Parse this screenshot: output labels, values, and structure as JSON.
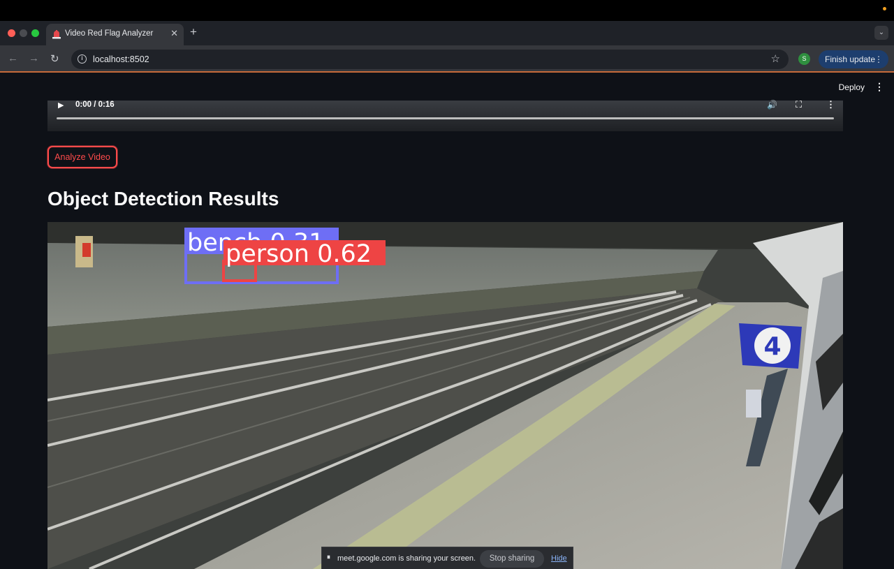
{
  "browser": {
    "tab_title": "Video Red Flag Analyzer",
    "tab_icon": "siren-icon",
    "new_tab_label": "+",
    "url": "localhost:8502",
    "profile_initial": "S",
    "finish_update_label": "Finish update"
  },
  "app": {
    "deploy_label": "Deploy",
    "video": {
      "time": "0:00 / 0:16",
      "progress": 0
    },
    "analyze_button_label": "Analyze Video",
    "results_title": "Object Detection Results",
    "detections": [
      {
        "label": "bench 0.31",
        "color": "#6e6ef5"
      },
      {
        "label": "person 0.62",
        "color": "#ee4444"
      }
    ],
    "platform_sign": "4"
  },
  "share_bar": {
    "text": "meet.google.com is sharing your screen.",
    "stop_label": "Stop sharing",
    "hide_label": "Hide"
  },
  "colors": {
    "app_bg": "#0e1117",
    "accent": "#ff4b4b",
    "toolbar": "#35373c"
  }
}
